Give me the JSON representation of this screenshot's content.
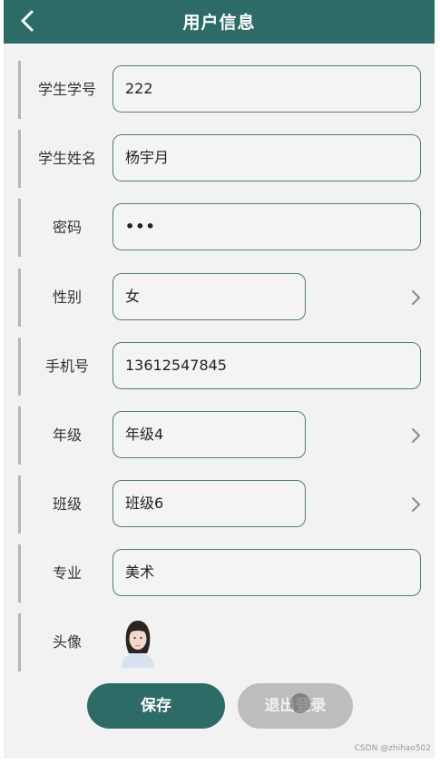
{
  "header": {
    "title": "用户信息",
    "back_icon": "chevron-left-icon"
  },
  "form": {
    "student_id": {
      "label": "学生学号",
      "value": "222"
    },
    "student_name": {
      "label": "学生姓名",
      "value": "杨宇月"
    },
    "password": {
      "label": "密码",
      "value": "•••"
    },
    "gender": {
      "label": "性别",
      "value": "女"
    },
    "phone": {
      "label": "手机号",
      "value": "13612547845"
    },
    "grade": {
      "label": "年级",
      "value": "年级4"
    },
    "class": {
      "label": "班级",
      "value": "班级6"
    },
    "major": {
      "label": "专业",
      "value": "美术"
    },
    "avatar": {
      "label": "头像"
    }
  },
  "buttons": {
    "save": "保存",
    "logout": "退出登录"
  },
  "watermark": "CSDN @zhihao502",
  "colors": {
    "primary": "#2d6b67",
    "background": "#f2f2f2",
    "disabled": "#bdbdbd"
  }
}
